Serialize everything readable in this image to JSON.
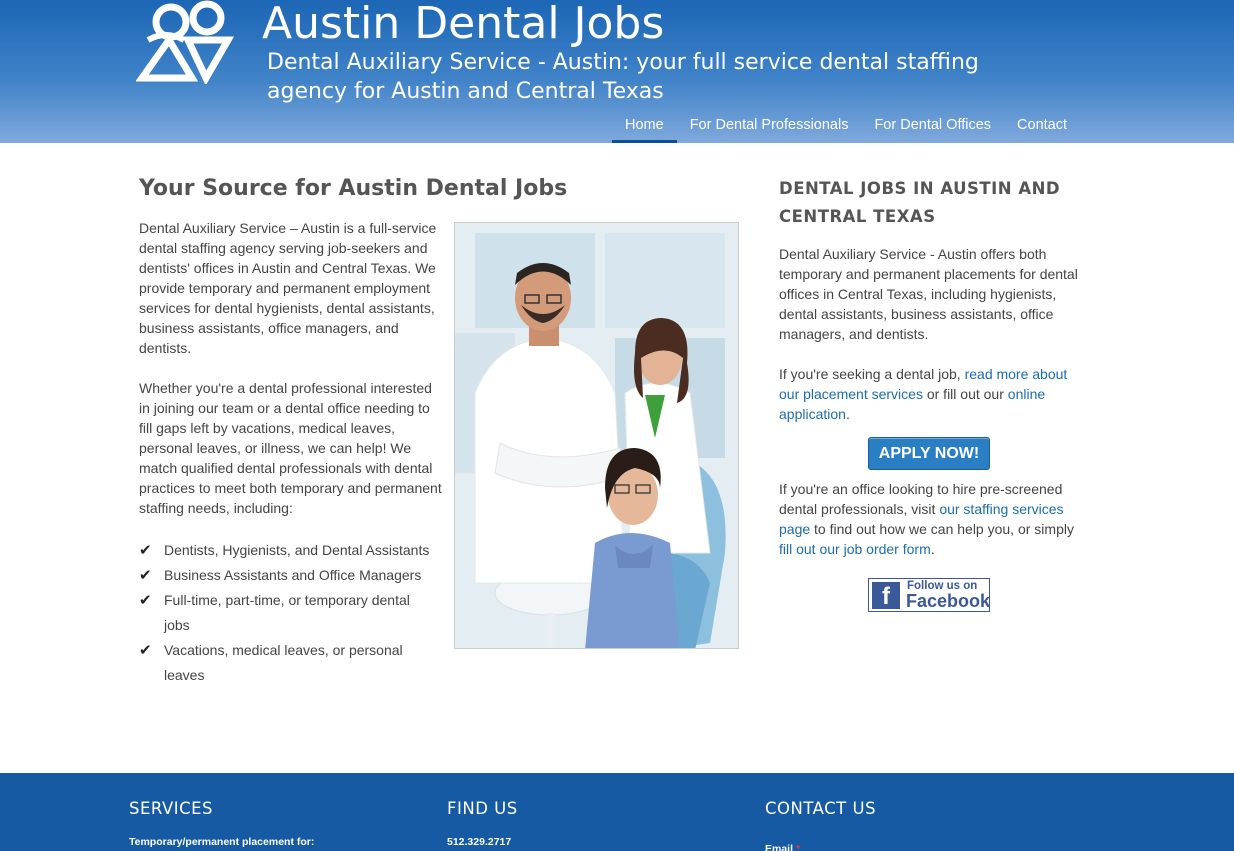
{
  "header": {
    "site_title": "Austin Dental Jobs",
    "tagline": "Dental Auxiliary Service - Austin: your full service dental staffing agency for Austin and Central Texas"
  },
  "nav": {
    "items": [
      {
        "label": "Home",
        "active": true
      },
      {
        "label": "For Dental Professionals",
        "active": false
      },
      {
        "label": "For Dental Offices",
        "active": false
      },
      {
        "label": "Contact",
        "active": false
      }
    ]
  },
  "main": {
    "title": "Your Source for Austin Dental Jobs",
    "paragraph1": "Dental Auxiliary Service – Austin is a full-service dental staffing agency serving job-seekers and dentists' offices in Austin and Central Texas. We provide temporary and permanent employment services for dental hygienists, dental assistants, business assistants, office managers, and dentists.",
    "paragraph2": "Whether you're a dental professional interested in joining our team or a dental office needing to fill gaps left by vacations, medical leaves, personal leaves, or illness, we can help! We match qualified dental professionals with dental practices to meet both temporary and permanent staffing needs, including:",
    "checklist": [
      "Dentists, Hygienists, and Dental Assistants",
      "Business Assistants and Office Managers",
      "Full-time, part-time, or temporary dental jobs",
      "Vacations, medical leaves, or personal leaves"
    ],
    "check_glyph": "✔"
  },
  "sidebar": {
    "title": "Dental Jobs in Austin and Central Texas",
    "p1": "Dental Auxiliary Service - Austin offers both temporary and permanent placements for dental offices in Central Texas, including hygienists, dental assistants, business assistants, office managers, and dentists.",
    "p2_pre": "If you're seeking a dental job, ",
    "p2_link1": "read more about our placement services",
    "p2_mid": " or fill out our ",
    "p2_link2": "online application",
    "p2_end": ".",
    "apply_button": "APPLY NOW!",
    "p3_pre": "If you're an office looking to hire pre-screened dental professionals, visit ",
    "p3_link1": "our staffing services page",
    "p3_mid": " to find out how we can help you, or simply ",
    "p3_link2": "fill out our job order form",
    "p3_end": ".",
    "facebook": {
      "letter": "f",
      "small": "Follow us on",
      "big": "Facebook"
    }
  },
  "footer": {
    "services_heading": "SERVICES",
    "services_text": "Temporary/permanent placement for:",
    "findus_heading": "FIND US",
    "phone": "512.329.2717",
    "contact_heading": "CONTACT US",
    "email_label": "Email",
    "required_mark": "*"
  },
  "colors": {
    "header_top": "#1c66b5",
    "header_bottom": "#7fa9dc",
    "link": "#1b6db0",
    "button": "#2a7ec4",
    "footer": "#155aa3",
    "facebook": "#3b5998"
  }
}
